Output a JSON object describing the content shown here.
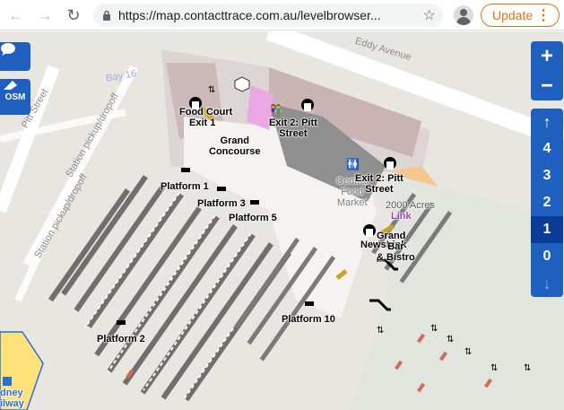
{
  "browser": {
    "url": "https://map.contacttrace.com.au/levelbrowser...",
    "update_label": "Update"
  },
  "map": {
    "streets": [
      "Eddy Avenue",
      "Pitt Street",
      "Station pickup/dropoff",
      "Station pickup/dropoff",
      "Bay 16"
    ],
    "labels": {
      "food_court": "Food Court",
      "exit1": "Exit 1",
      "exit2_top": "Exit 2: Pitt\nStreet",
      "grand_concourse": "Grand\nConcourse",
      "central_food_market": "Central\nFood\nMarket",
      "exit2_right": "Exit 2: Pitt\nStreet",
      "acres": "2000 Acres",
      "link": "Link",
      "newslink": "NewsLink",
      "grand_bar": "Grand\nBar\n& Bistro",
      "platform1": "Platform 1",
      "platform3": "Platform 3",
      "platform5": "Platform 5",
      "platform10": "Platform 10",
      "platform2": "Platform 2",
      "sydney_railway": "Sydney\nRailway"
    }
  },
  "controls": {
    "chat_icon": "chat-bubble-icon",
    "osm_label": "OSM",
    "zoom_in": "+",
    "zoom_out": "−",
    "level_up": "↑",
    "levels": [
      "4",
      "3",
      "2",
      "1",
      "0"
    ],
    "active_level": "1",
    "level_down": "↓"
  }
}
